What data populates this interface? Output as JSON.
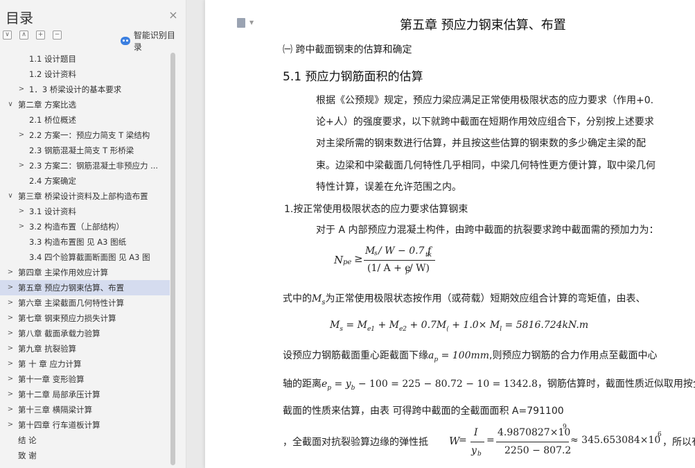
{
  "sidebar": {
    "title": "目录",
    "close_icon": "×",
    "smart_label": "智能识别目录",
    "tool_buttons": [
      "∨",
      "∧",
      "+",
      "−"
    ],
    "items": [
      {
        "label": "1.1 设计题目",
        "level": 2,
        "arrow": ""
      },
      {
        "label": "1.2  设计资料",
        "level": 2,
        "arrow": ""
      },
      {
        "label": "1．3  桥梁设计的基本要求",
        "level": 2,
        "arrow": ">"
      },
      {
        "label": "第二章  方案比选",
        "level": 1,
        "arrow": "∨"
      },
      {
        "label": "2.1 桥位概述",
        "level": 2,
        "arrow": ""
      },
      {
        "label": "2.2  方案一：预应力简支 T 梁结构",
        "level": 2,
        "arrow": ">"
      },
      {
        "label": "2.3  钢筋混凝土简支 T 形桥梁",
        "level": 2,
        "arrow": ""
      },
      {
        "label": "2.3  方案二：钢筋混凝土非预应力 ...",
        "level": 2,
        "arrow": ">"
      },
      {
        "label": "2.4  方案确定",
        "level": 2,
        "arrow": ""
      },
      {
        "label": "第三章  桥梁设计资料及上部构造布置",
        "level": 1,
        "arrow": "∨"
      },
      {
        "label": "3.1 设计资料",
        "level": 2,
        "arrow": ">"
      },
      {
        "label": "3.2 构造布置（上部结构）",
        "level": 2,
        "arrow": ">"
      },
      {
        "label": "3.3 构造布置图  见 A3 图纸",
        "level": 2,
        "arrow": ""
      },
      {
        "label": "3.4  四个验算截面断面图  见 A3 图",
        "level": 2,
        "arrow": ""
      },
      {
        "label": "第四章  主梁作用效应计算",
        "level": 1,
        "arrow": ">"
      },
      {
        "label": "第五章  预应力钢束估算、布置",
        "level": 1,
        "arrow": ">",
        "active": true
      },
      {
        "label": "第六章  主梁截面几何特性计算",
        "level": 1,
        "arrow": ">"
      },
      {
        "label": "第七章  钢束预应力损失计算",
        "level": 1,
        "arrow": ">"
      },
      {
        "label": "第八章    截面承载力验算",
        "level": 1,
        "arrow": ">"
      },
      {
        "label": "第九章  抗裂验算",
        "level": 1,
        "arrow": ">"
      },
      {
        "label": "第 十 章  应力计算",
        "level": 1,
        "arrow": ">"
      },
      {
        "label": "第十一章  变形验算",
        "level": 1,
        "arrow": ">"
      },
      {
        "label": "第十二章  局部承压计算",
        "level": 1,
        "arrow": ">"
      },
      {
        "label": "第十三章  横隔梁计算",
        "level": 1,
        "arrow": ">"
      },
      {
        "label": "第十四章  行车道板计算",
        "level": 1,
        "arrow": ">"
      },
      {
        "label": "结    论",
        "level": 1,
        "arrow": ""
      },
      {
        "label": "致    谢",
        "level": 1,
        "arrow": ""
      }
    ]
  },
  "document": {
    "chapter_title": "第五章  预应力钢束估算、布置",
    "section_heading": "㈠ 跨中截面钢束的估算和确定",
    "subsection": "5.1 预应力钢筋面积的估算",
    "para1": [
      "根据《公预规》规定，预应力梁应满足正常使用极限状态的应力要求（作用+0.",
      "论+人）的强度要求，以下就跨中截面在短期作用效应组合下，分别按上述要求",
      "对主梁所需的钢束数进行估算，并且按这些估算的钢束数的多少确定主梁的配",
      "束。边梁和中梁截面几何特性几乎相同，中梁几何特性更方便计算，取中梁几何",
      "特性计算，误差在允许范围之内。"
    ],
    "item1": "1.按正常使用极限状态的应力要求估算钢束",
    "para2": "对于 A 内部预应力混凝土构件，由跨中截面的抗裂要求跨中截面需的预加力为：",
    "eq1_lhs": "N",
    "eq1_sub": "pe",
    "eq1_ge": "≥",
    "eq1_num": "M",
    "eq1_num_sub": "s",
    "eq1_num_rest": "/ W − 0.7 f",
    "eq1_num_sub2": "tk",
    "eq1_den": "(1/ A + e",
    "eq1_den_sub": "p",
    "eq1_den_rest": "/ W)",
    "para3_pre": "式中的",
    "para3_var": "M",
    "para3_sub": "s",
    "para3_post": "为正常使用极限状态按作用（或荷载）短期效应组合计算的弯矩值，由表、",
    "eq2": "M s = M e1 + M e2 + 0.7M 汽 + 1.0× M 人 = 5816.724kN.m",
    "eq2_parts": [
      "M",
      "s",
      " = M",
      "e1",
      " + M",
      "e2",
      " + 0.7M",
      "(",
      " + 1.0× M",
      "l",
      " = 5816.724kN.m"
    ],
    "para4_pre": "设预应力钢筋截面重心距截面下缘",
    "para4_eq": "a",
    "para4_sub": "p",
    "para4_val": " = 100mm",
    "para4_post": ",则预应力钢筋的合力作用点至截面中心",
    "para5_pre": "轴的距离",
    "para5_eq": "e",
    "para5_sub": "p",
    "para5_mid": " = y",
    "para5_sub2": "b",
    "para5_val": " − 100 = 225 − 80.72 − 10 = 1342.8",
    "para5_post": "，钢筋估算时，截面性质近似取用按全",
    "para6": "截面的性质来估算，由表      可得跨中截面的全截面面积 A=791100",
    "para7_pre": "，全截面对抗裂验算边缘的弹性抵",
    "para7_W": "W",
    "para7_eq1": " = ",
    "para7_f1_num": "I",
    "para7_f1_den": "y",
    "para7_f1_den_sub": "b",
    "para7_f2_num": "4.9870827×10",
    "para7_f2_num_sup": "9",
    "para7_f2_den": "2250 − 807.2",
    "para7_approx": "≈ 345.653084×10",
    "para7_sup": "6",
    "para7_post": "，所以有"
  }
}
